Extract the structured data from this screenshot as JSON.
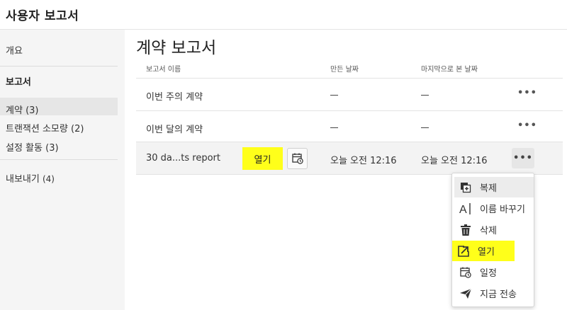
{
  "app": {
    "title": "사용자 보고서"
  },
  "sidebar": {
    "overview": "개요",
    "reports_heading": "보고서",
    "items": [
      {
        "label": "계약",
        "count": "(3)"
      },
      {
        "label": "트랜잭션 소모량",
        "count": "(2)"
      },
      {
        "label": "설정 활동",
        "count": "(3)"
      }
    ],
    "export": {
      "label": "내보내기",
      "count": "(4)"
    }
  },
  "main": {
    "title": "계약 보고서",
    "columns": {
      "name": "보고서 이름",
      "created": "만든 날짜",
      "last_viewed": "마지막으로 본 날짜"
    },
    "rows": [
      {
        "name": "이번 주의 계약"
      },
      {
        "name": "이번 달의 계약"
      },
      {
        "name": "30 da...ts report",
        "created": "오늘 오전 12:16",
        "last_viewed": "오늘 오전 12:16"
      }
    ],
    "row_actions": {
      "open": "열기"
    }
  },
  "menu": {
    "items": [
      {
        "label": "복제",
        "icon": "duplicate-icon"
      },
      {
        "label": "이름 바꾸기",
        "icon": "rename-icon"
      },
      {
        "label": "삭제",
        "icon": "trash-icon"
      },
      {
        "label": "열기",
        "icon": "open-icon"
      },
      {
        "label": "일정",
        "icon": "calendar-clock-icon"
      },
      {
        "label": "지금 전송",
        "icon": "send-icon"
      }
    ]
  },
  "colors": {
    "highlight": "#ffff1a",
    "sidebar_bg": "#f5f5f5"
  }
}
